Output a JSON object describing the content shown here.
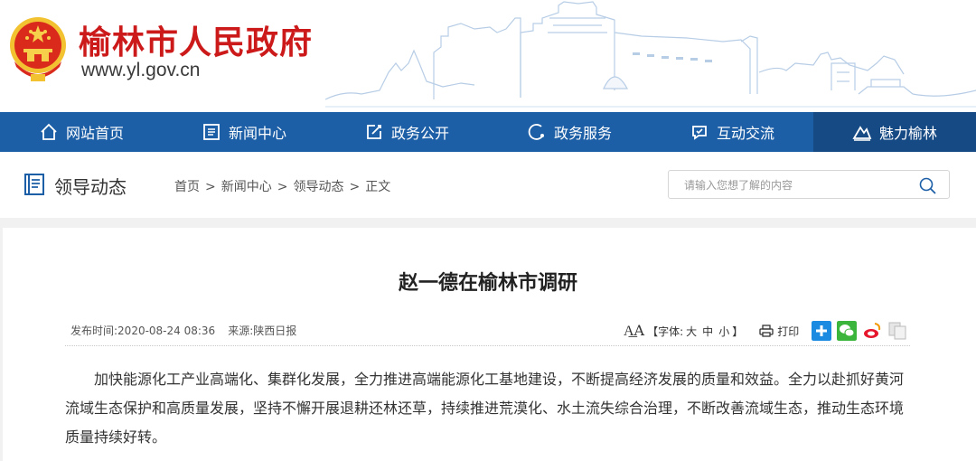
{
  "header": {
    "site_title": "榆林市人民政府",
    "site_url": "www.yl.gov.cn",
    "emblem_icon": "national-emblem",
    "title_color": "#cc1a1a"
  },
  "nav": {
    "bg_color": "#1d5fa6",
    "items": [
      {
        "label": "网站首页",
        "icon": "home-icon"
      },
      {
        "label": "新闻中心",
        "icon": "news-icon"
      },
      {
        "label": "政务公开",
        "icon": "edit-icon"
      },
      {
        "label": "政务服务",
        "icon": "service-icon"
      },
      {
        "label": "互动交流",
        "icon": "chat-icon"
      },
      {
        "label": "魅力榆林",
        "icon": "mountain-icon",
        "active": true
      }
    ]
  },
  "location": {
    "title": "领导动态",
    "breadcrumb": [
      "首页",
      "新闻中心",
      "领导动态",
      "正文"
    ],
    "separator": ">"
  },
  "search": {
    "placeholder": "请输入您想了解的内容"
  },
  "article": {
    "title": "赵一德在榆林市调研",
    "publish_label": "发布时间:",
    "publish_time": "2020-08-24 08:36",
    "source_label": "来源:",
    "source": "陕西日报",
    "font_size_label": "【字体:",
    "font_sizes": [
      "大",
      "中",
      "小"
    ],
    "font_size_close": "】",
    "print_label": "打印",
    "share_icons": [
      "plus-share-icon",
      "wechat-icon",
      "weibo-icon",
      "copy-icon"
    ],
    "body": "加快能源化工产业高端化、集群化发展，全力推进高端能源化工基地建设，不断提高经济发展的质量和效益。全力以赴抓好黄河流域生态保护和高质量发展，坚持不懈开展退耕还林还草，持续推进荒漠化、水土流失综合治理，不断改善流域生态，推动生态环境质量持续好转。"
  }
}
